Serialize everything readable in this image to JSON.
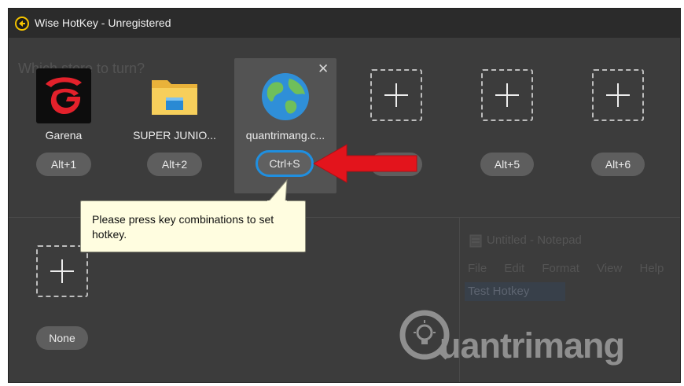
{
  "window": {
    "title": "Wise HotKey - Unregistered"
  },
  "background": {
    "ghost_text": "Which store to turn?"
  },
  "slots": [
    {
      "label": "Garena",
      "hotkey": "Alt+1",
      "icon": "garena-icon"
    },
    {
      "label": "SUPER JUNIO...",
      "hotkey": "Alt+2",
      "icon": "folder-icon"
    },
    {
      "label": "quantrimang.c...",
      "hotkey": "Ctrl+S",
      "icon": "globe-icon",
      "active": true
    },
    {
      "label": "",
      "hotkey": "",
      "icon": "add-icon"
    },
    {
      "label": "",
      "hotkey": "Alt+5",
      "icon": "add-icon"
    },
    {
      "label": "",
      "hotkey": "Alt+6",
      "icon": "add-icon"
    }
  ],
  "second_row": {
    "hotkey": "None",
    "icon": "add-icon"
  },
  "tooltip": {
    "text": "Please press key combinations to set hotkey."
  },
  "notepad_behind": {
    "title": "Untitled - Notepad",
    "menu": [
      "File",
      "Edit",
      "Format",
      "View",
      "Help"
    ],
    "selected_text": "Test Hotkey"
  },
  "watermark": {
    "text": "uantrimang"
  },
  "colors": {
    "active_key_border": "#1f8fe0",
    "arrow": "#e3141c",
    "tooltip_bg": "#fffde0"
  }
}
